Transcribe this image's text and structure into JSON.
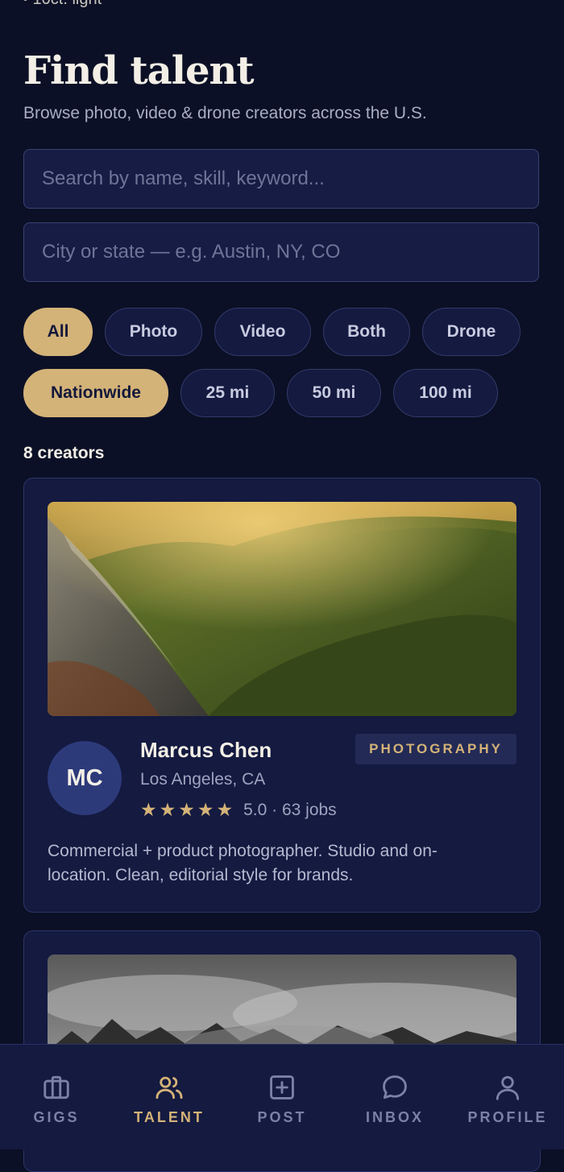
{
  "top_fragment": "• 10ct. light",
  "header": {
    "title": "Find talent",
    "subtitle": "Browse photo, video & drone creators across the U.S."
  },
  "search": {
    "keyword_placeholder": "Search by name, skill, keyword...",
    "keyword_value": "",
    "location_placeholder": "City or state — e.g. Austin, NY, CO",
    "location_value": ""
  },
  "filters": {
    "categories": [
      "All",
      "Photo",
      "Video",
      "Both",
      "Drone"
    ],
    "selected_category": "All",
    "distances": [
      "Nationwide",
      "25 mi",
      "50 mi",
      "100 mi"
    ],
    "selected_distance": "Nationwide"
  },
  "results": {
    "count_label": "8 creators"
  },
  "creators": [
    {
      "initials": "MC",
      "name": "Marcus Chen",
      "location": "Los Angeles, CA",
      "category": "PHOTOGRAPHY",
      "stars": "★★★★★",
      "rating_text": "5.0 · 63 jobs",
      "bio": "Commercial + product photographer. Studio and on-location. Clean, editorial style for brands."
    }
  ],
  "bottom_nav": {
    "items": [
      {
        "label": "GIGS",
        "icon": "briefcase-icon"
      },
      {
        "label": "TALENT",
        "icon": "users-icon"
      },
      {
        "label": "POST",
        "icon": "plus-square-icon"
      },
      {
        "label": "INBOX",
        "icon": "chat-bubble-icon"
      },
      {
        "label": "PROFILE",
        "icon": "person-icon"
      }
    ],
    "active": "TALENT"
  },
  "colors": {
    "background": "#0b1026",
    "surface": "#141a40",
    "accent": "#d4b378",
    "avatar": "#2d3a7a"
  }
}
